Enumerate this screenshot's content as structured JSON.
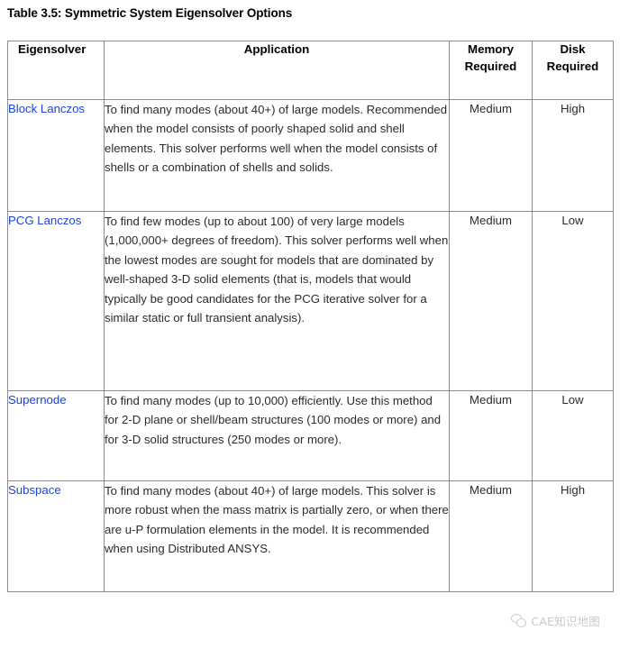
{
  "table": {
    "caption": "Table 3.5: Symmetric System Eigensolver Options",
    "headers": {
      "eigensolver": "Eigensolver",
      "application": "Application",
      "memory_required": "Memory\nRequired",
      "memory_required_line1": "Memory",
      "memory_required_line2": "Required",
      "disk_required": "Disk\nRequired",
      "disk_required_line1": "Disk",
      "disk_required_line2": "Required"
    },
    "link_color": "#1a44d8",
    "header_background": "#e0e0e0",
    "border_color": "#8d8d8d",
    "rows": [
      {
        "eigensolver": "Block Lanczos",
        "application": "To find many modes (about 40+) of large models. Recommended when the model consists of poorly shaped solid and shell elements. This solver performs well when the model consists of shells or a combination of shells and solids.",
        "memory_required": "Medium",
        "disk_required": "High"
      },
      {
        "eigensolver": "PCG Lanczos",
        "application": "To find few modes (up to about 100) of very large models (1,000,000+ degrees of freedom). This solver performs well when the lowest modes are sought for models that are dominated by well-shaped 3-D solid elements (that is, models that would typically be good candidates for the PCG iterative solver for a similar static or full transient analysis).",
        "memory_required": "Medium",
        "disk_required": "Low"
      },
      {
        "eigensolver": "Supernode",
        "application": "To find many modes (up to 10,000) efficiently. Use this method for 2-D plane or shell/beam structures (100 modes or more) and for 3-D solid structures (250 modes or more).",
        "memory_required": "Medium",
        "disk_required": "Low"
      },
      {
        "eigensolver": "Subspace",
        "application": "To find many modes (about 40+) of large models. This solver is more robust when the mass matrix is partially zero, or when there are u-P formulation elements in the model. It is recommended when using Distributed ANSYS.",
        "memory_required": "Medium",
        "disk_required": "High"
      }
    ]
  },
  "watermark": {
    "text": "CAE知识地图",
    "icon": "wechat-logo-icon"
  }
}
